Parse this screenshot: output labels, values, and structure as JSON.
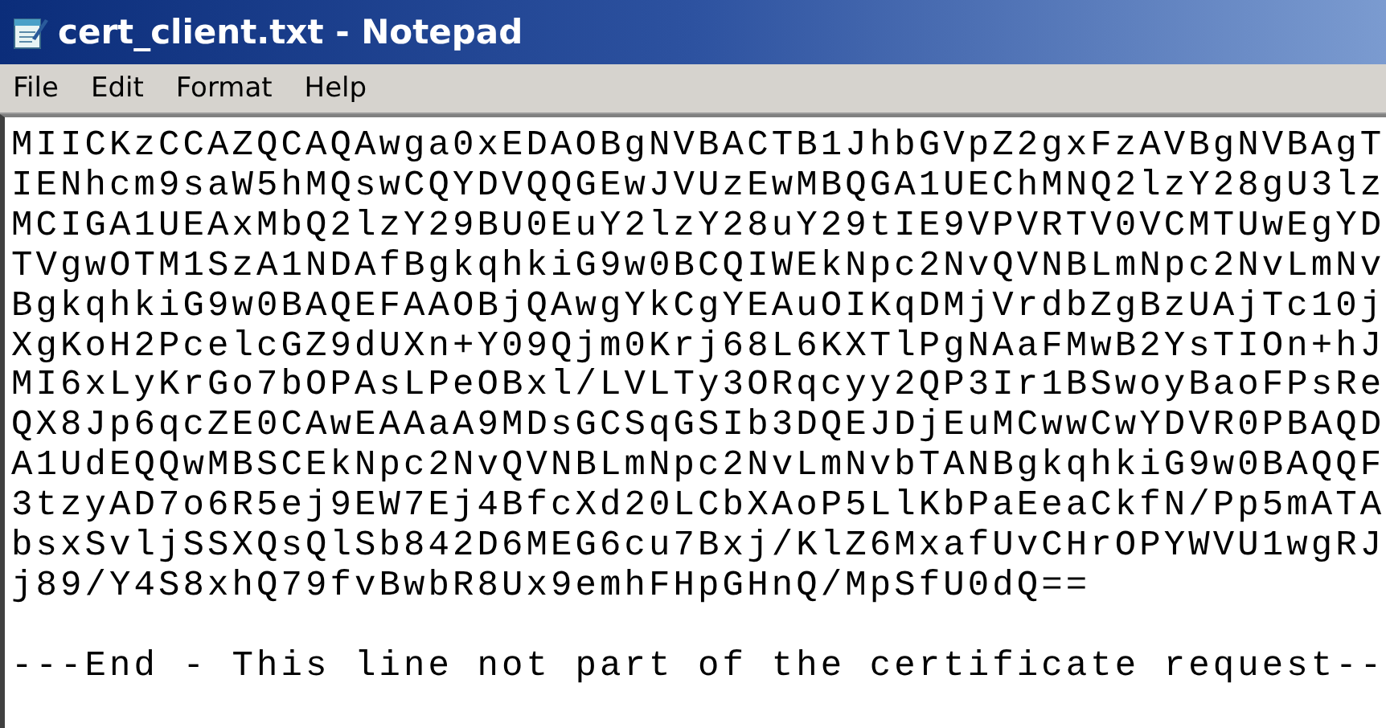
{
  "window": {
    "title": "cert_client.txt - Notepad"
  },
  "menu": [
    {
      "label": "File"
    },
    {
      "label": "Edit"
    },
    {
      "label": "Format"
    },
    {
      "label": "Help"
    }
  ],
  "editor": {
    "lines": [
      "MIICKzCCAZQCAQAwga0xEDAOBgNVBACTB1JhbGVpZ2gxFzAVBgNVBAgT",
      "IENhcm9saW5hMQswCQYDVQQGEwJVUzEwMBQGA1UEChMNQ2lzY28gU3lz",
      "MCIGA1UEAxMbQ2lzY29BU0EuY2lzY28uY29tIE9VPVRTV0VCMTUwEgYD",
      "TVgwOTM1SzA1NDAfBgkqhkiG9w0BCQIWEkNpc2NvQVNBLmNpc2NvLmNv",
      "BgkqhkiG9w0BAQEFAAOBjQAwgYkCgYEAuOIKqDMjVrdbZgBzUAjTc10j",
      "XgKoH2PcelcGZ9dUXn+Y09Qjm0Krj68L6KXTlPgNAaFMwB2YsTIOn+hJ",
      "MI6xLyKrGo7bOPAsLPeOBxl/LVLTy3ORqcyy2QP3Ir1BSwoyBaoFPsRe",
      "QX8Jp6qcZE0CAwEAAaA9MDsGCSqGSIb3DQEJDjEuMCwwCwYDVR0PBAQD",
      "A1UdEQQwMBSCEkNpc2NvQVNBLmNpc2NvLmNvbTANBgkqhkiG9w0BAQQF",
      "3tzyAD7o6R5ej9EW7Ej4BfcXd20LCbXAoP5LlKbPaEeaCkfN/Pp5mATA",
      "bsxSvljSSXQsQlSb842D6MEG6cu7Bxj/KlZ6MxafUvCHrOPYWVU1wgRJ",
      "j89/Y4S8xhQ79fvBwbR8Ux9emhFHpGHnQ/MpSfU0dQ=="
    ],
    "end_line": "---End - This line not part of the certificate request--"
  }
}
